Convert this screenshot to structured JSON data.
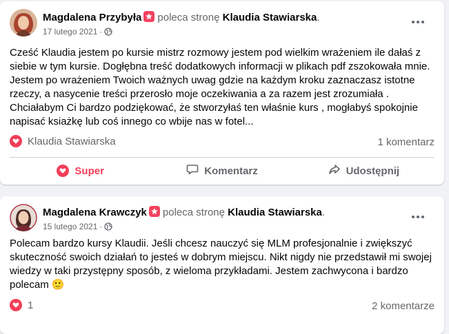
{
  "colors": {
    "background": "#f0f2f5",
    "card": "#ffffff",
    "reaction": "#f33e58",
    "muted": "#65676b"
  },
  "posts": [
    {
      "author": "Magdalena Przybyła",
      "verb": "poleca stronę",
      "page": "Klaudia Stawiarska",
      "date": "17 lutego 2021",
      "separator": "·",
      "audience_icon": "globe-icon",
      "more_icon": "more-options-icon",
      "text": "Cześć Klaudia jestem po kursie mistrz rozmowy jestem pod wielkim wrażeniem ile dałaś z siebie w tym kursie. Dogłębna treść dodatkowych informacji  w plikach pdf zszokowała mnie. Jestem  po wrażeniem Twoich ważnych uwag gdzie na każdym kroku zaznaczasz istotne rzeczy, a nasycenie treści przerosło moje oczekiwania a za razem jest  zrozumiała . Chciałabym Ci bardzo podziękować, że stworzyłaś ten właśnie kurs , mogłabyś spokojnie napisać ksiażkę lub coś innego co wbije nas w fotel...",
      "reactions_label": "Klaudia Stawiarska",
      "comments_count": "1 komentarz",
      "actions": {
        "like": "Super",
        "comment": "Komentarz",
        "share": "Udostępnij"
      }
    },
    {
      "author": "Magdalena Krawczyk",
      "verb": "poleca stronę",
      "page": "Klaudia Stawiarska",
      "date": "15 lutego 2021",
      "separator": "·",
      "audience_icon": "globe-icon",
      "more_icon": "more-options-icon",
      "text": "Polecam bardzo kursy Klaudii. Jeśli chcesz nauczyć się MLM profesjonalnie i zwiększyć skuteczność swoich działań to jesteś w dobrym miejscu. Nikt nigdy nie przedstawił mi swojej wiedzy w taki przystępny sposób, z wieloma przykładami. Jestem zachwycona i bardzo polecam",
      "emoji": "🙂",
      "reactions_label": "1",
      "comments_count": "2 komentarze"
    }
  ]
}
